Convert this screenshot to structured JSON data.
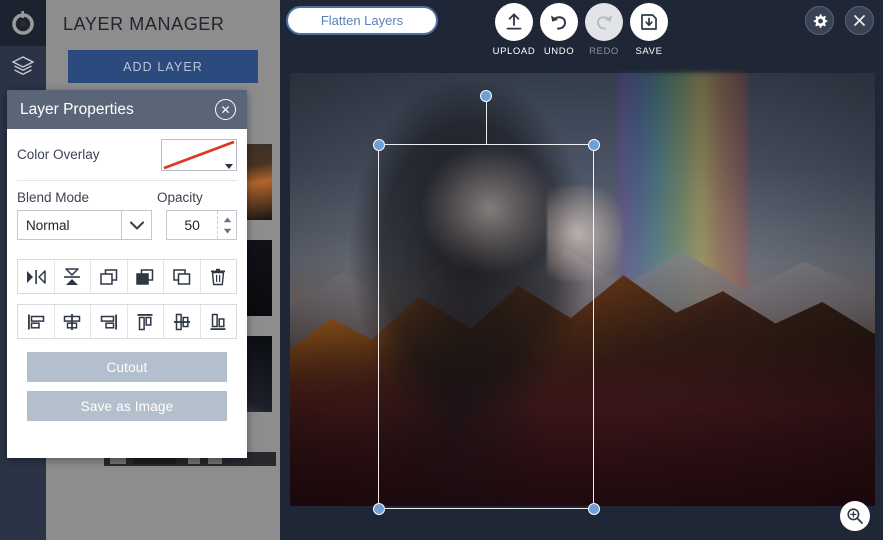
{
  "app": {
    "logo_icon": "logo-icon",
    "rail_layers_icon": "layers-stack-icon"
  },
  "layer_manager": {
    "title": "LAYER MANAGER",
    "add_layer_label": "ADD LAYER",
    "layers": [
      {
        "name": "layer-thumbnail-1"
      },
      {
        "name": "layer-thumbnail-2"
      },
      {
        "name": "layer-thumbnail-3"
      }
    ]
  },
  "layer_properties": {
    "title": "Layer Properties",
    "close_icon": "✕",
    "color_overlay_label": "Color Overlay",
    "color_overlay_value": "none",
    "color_overlay_slash_color": "#d93a22",
    "blend_mode_label": "Blend Mode",
    "blend_mode_value": "Normal",
    "blend_mode_options": [
      "Normal"
    ],
    "opacity_label": "Opacity",
    "opacity_value": "50",
    "transform_tools": [
      {
        "name": "flip-horizontal-icon"
      },
      {
        "name": "flip-vertical-icon"
      },
      {
        "name": "bring-forward-icon"
      },
      {
        "name": "bring-to-front-icon"
      },
      {
        "name": "duplicate-icon"
      },
      {
        "name": "delete-icon"
      }
    ],
    "align_tools": [
      {
        "name": "align-left-icon"
      },
      {
        "name": "align-center-horizontal-icon"
      },
      {
        "name": "align-right-icon"
      },
      {
        "name": "align-top-icon"
      },
      {
        "name": "align-middle-vertical-icon"
      },
      {
        "name": "align-bottom-icon"
      }
    ],
    "cutout_label": "Cutout",
    "save_as_image_label": "Save as Image"
  },
  "toolbar": {
    "flatten_label": "Flatten Layers",
    "actions": [
      {
        "label": "UPLOAD",
        "icon": "upload-icon",
        "disabled": false
      },
      {
        "label": "UNDO",
        "icon": "undo-icon",
        "disabled": false
      },
      {
        "label": "REDO",
        "icon": "redo-icon",
        "disabled": true
      },
      {
        "label": "SAVE",
        "icon": "save-icon",
        "disabled": false
      }
    ],
    "settings_icon": "gear-icon",
    "close_icon": "close-icon"
  },
  "canvas": {
    "zoom_icon": "zoom-in-icon",
    "selection": {
      "handles": 4,
      "rotate_handle": true
    }
  },
  "colors": {
    "app_bg": "#1f2635",
    "panel_bg": "#8d8d8d",
    "dialog_header": "#5b6578",
    "accent_blue": "#2b4a7d",
    "handle_blue": "#6e9fd6",
    "button_grey": "#b4bfcd"
  }
}
